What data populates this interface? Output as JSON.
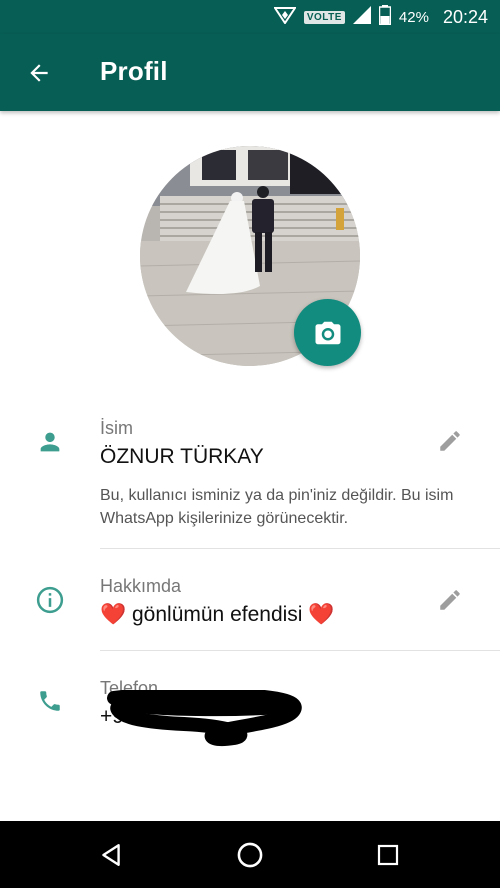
{
  "status_bar": {
    "network_badge": "VOLTE",
    "battery": "42%",
    "time": "20:24"
  },
  "app_bar": {
    "title": "Profil"
  },
  "name_section": {
    "label": "İsim",
    "value": "ÖZNUR TÜRKAY",
    "description": "Bu, kullanıcı isminiz ya da pin'iniz değildir. Bu isim WhatsApp kişilerinize görünecektir."
  },
  "about_section": {
    "label": "Hakkımda",
    "text": "gönlümün efendisi",
    "emoji": "❤️"
  },
  "phone_section": {
    "label": "Telefon",
    "value_prefix": "+9"
  },
  "colors": {
    "header": "#075e54",
    "accent": "#128c7e",
    "icon_teal": "#3d9e8f"
  },
  "icons": [
    "back-arrow-icon",
    "camera-icon",
    "person-icon",
    "info-icon",
    "phone-icon",
    "pencil-icon",
    "nav-back-icon",
    "nav-home-icon",
    "nav-recents-icon"
  ]
}
